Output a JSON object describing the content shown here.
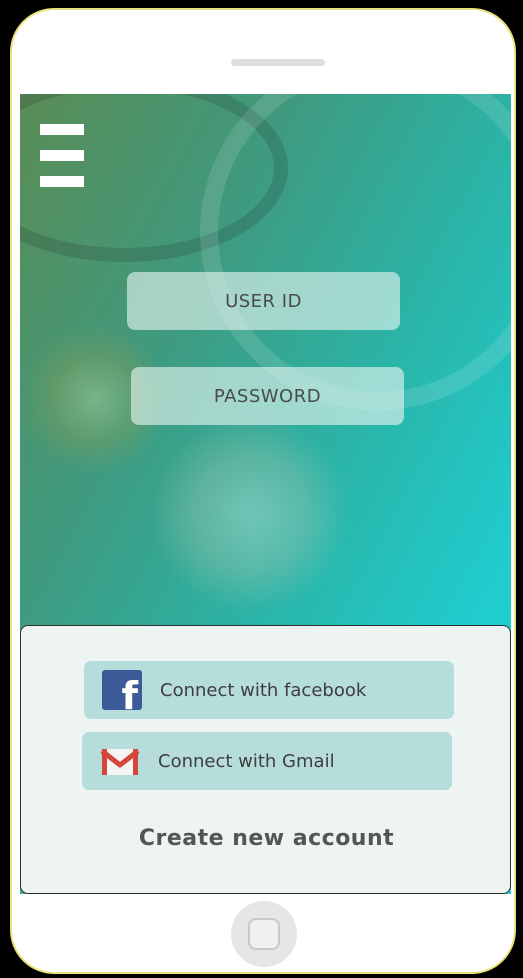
{
  "login": {
    "user_id_placeholder": "USER ID",
    "password_placeholder": "PASSWORD"
  },
  "social": {
    "facebook_label": "Connect with facebook",
    "gmail_label": "Connect with Gmail"
  },
  "create_account_label": "Create new account",
  "icons": {
    "menu": "hamburger-menu-icon",
    "facebook": "facebook-icon",
    "gmail": "gmail-icon",
    "home": "home-button-icon"
  },
  "colors": {
    "gradient_start": "#5a8c55",
    "gradient_end": "#1ed3d6",
    "button_bg": "#b7dcdc",
    "facebook_blue": "#3d5a98",
    "gmail_red": "#d44638"
  }
}
